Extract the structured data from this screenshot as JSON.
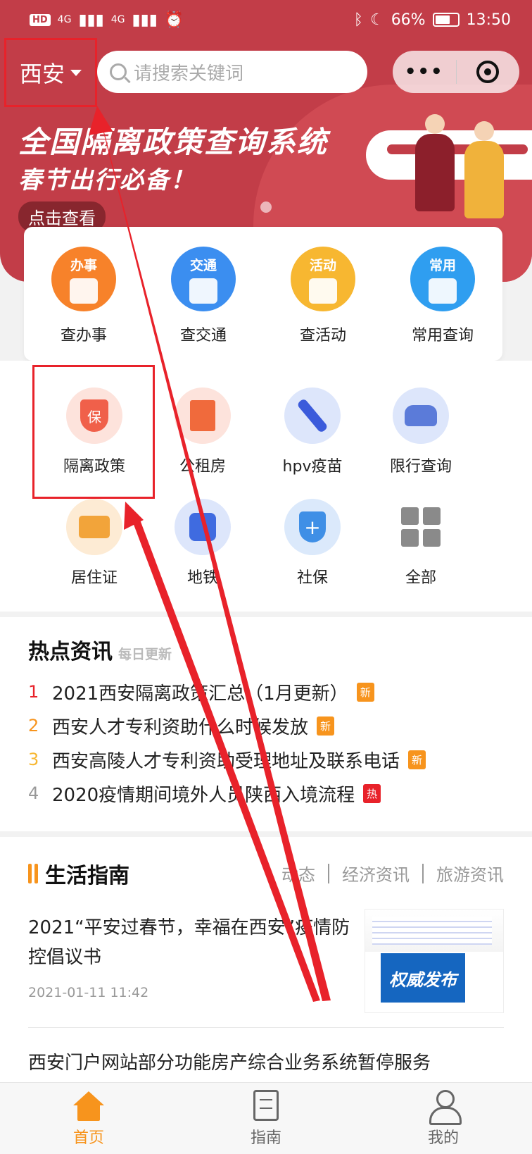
{
  "status": {
    "carrier_chip": "HD",
    "net1": "4G",
    "net2": "4G",
    "battery": "66%",
    "time": "13:50"
  },
  "header": {
    "city": "西安",
    "search_placeholder": "请搜索关键词"
  },
  "banner": {
    "title": "全国隔离政策查询系统",
    "subtitle": "春节出行必备！",
    "button": "点击查看"
  },
  "quick": [
    {
      "icon": "办事",
      "label": "查办事",
      "color": "#f7822a"
    },
    {
      "icon": "交通",
      "label": "查交通",
      "color": "#3b8ef0"
    },
    {
      "icon": "活动",
      "label": "查活动",
      "color": "#f7b731"
    },
    {
      "icon": "常用",
      "label": "常用查询",
      "color": "#2f9ef0"
    }
  ],
  "services": [
    {
      "label": "隔离政策",
      "glyph": "保"
    },
    {
      "label": "公租房"
    },
    {
      "label": "hpv疫苗"
    },
    {
      "label": "限行查询"
    },
    {
      "label": "居住证"
    },
    {
      "label": "地铁"
    },
    {
      "label": "社保",
      "glyph": "+"
    },
    {
      "label": "全部"
    }
  ],
  "hot": {
    "title": "热点资讯",
    "subtitle": "每日更新",
    "items": [
      {
        "num": "1",
        "text": "2021西安隔离政策汇总（1月更新）",
        "badge": "新",
        "num_color": "#e8222a",
        "badge_color": "#f7941d"
      },
      {
        "num": "2",
        "text": "西安人才专利资助什么时候发放",
        "badge": "新",
        "num_color": "#f7941d",
        "badge_color": "#f7941d"
      },
      {
        "num": "3",
        "text": "西安高陵人才专利资助受理地址及联系电话",
        "badge": "新",
        "num_color": "#f7b731",
        "badge_color": "#f7941d"
      },
      {
        "num": "4",
        "text": "2020疫情期间境外人员陕西入境流程",
        "badge": "热",
        "num_color": "#999999",
        "badge_color": "#e8222a"
      }
    ]
  },
  "life": {
    "title": "生活指南",
    "tabs": [
      "动态",
      "经济资讯",
      "旅游资讯"
    ],
    "article1": {
      "title": "2021“平安过春节，幸福在西安”疫情防控倡议书",
      "date": "2021-01-11 11:42",
      "thumb_text": "权威发布"
    },
    "article2": {
      "title": "西安门户网站部分功能房产综合业务系统暂停服务"
    }
  },
  "tabbar": {
    "home": "首页",
    "guide": "指南",
    "mine": "我的"
  },
  "colors": {
    "brand_red": "#c23d48",
    "accent_orange": "#f7941d",
    "annotation_red": "#e8222a"
  }
}
